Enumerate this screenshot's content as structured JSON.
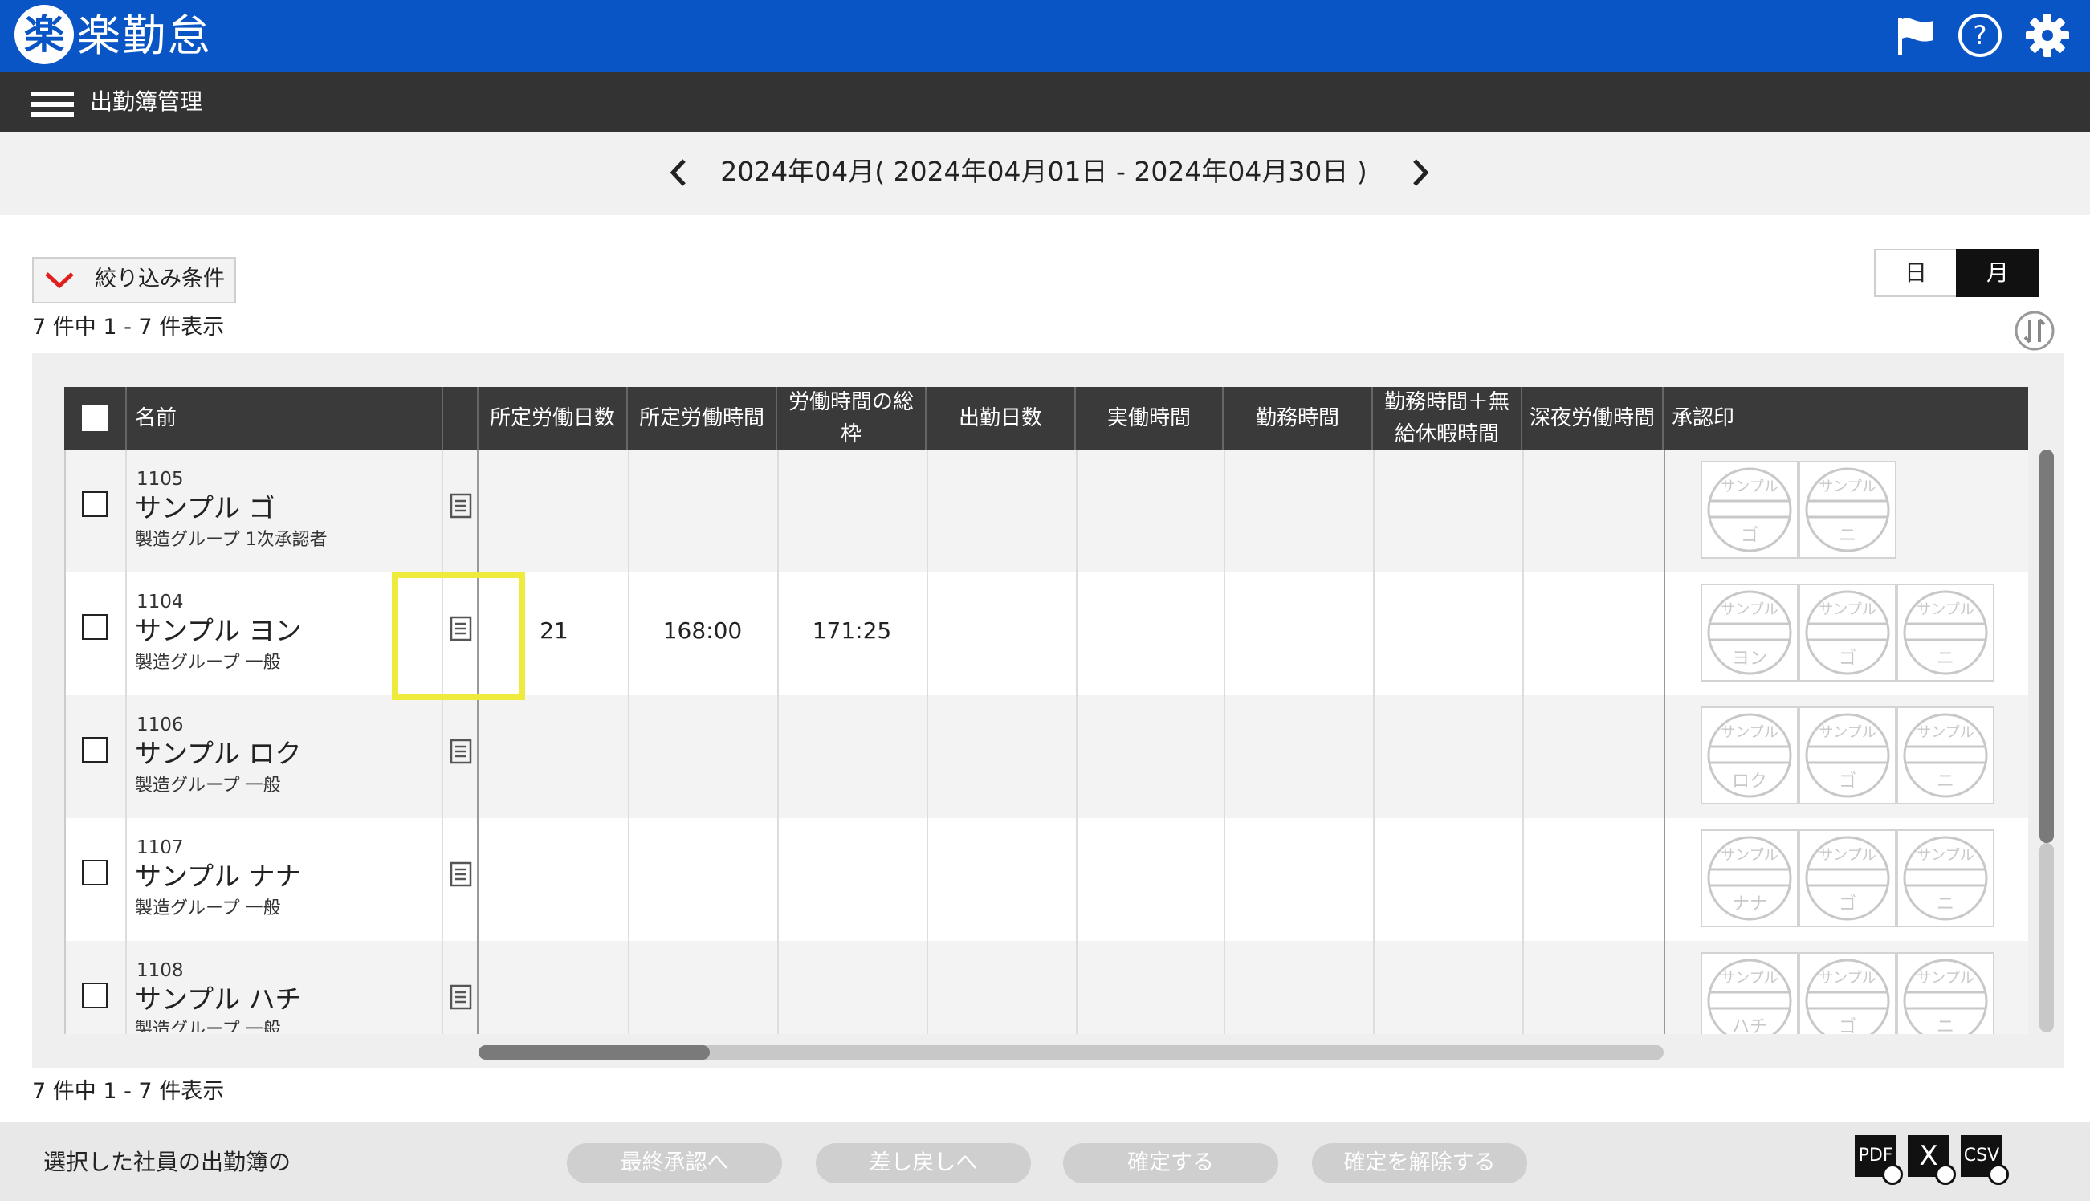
{
  "app": {
    "logo_glyph": "楽",
    "title": "楽勤怠",
    "brand_color": "#0a55c6"
  },
  "header_icons": [
    "flag-icon",
    "help-icon",
    "gear-icon"
  ],
  "subbar": {
    "title": "出勤簿管理"
  },
  "period": {
    "label": "2024年04月( 2024年04月01日 - 2024年04月30日 )"
  },
  "filter": {
    "label": "絞り込み条件"
  },
  "view_toggle": {
    "day": "日",
    "month": "月",
    "selected": "月"
  },
  "result_count": {
    "top": "7 件中 1 - 7 件表示",
    "bottom": "7 件中 1 - 7 件表示"
  },
  "table": {
    "columns": {
      "name": "名前",
      "scheduled_days": "所定労働日数",
      "scheduled_hours": "所定労働時間",
      "total_frame": "労働時間の総枠",
      "attendance_days": "出勤日数",
      "actual_hours": "実働時間",
      "work_hours": "勤務時間",
      "work_plus_unpaid": "勤務時間＋無給休暇時間",
      "night_hours": "深夜労働時間",
      "approval": "承認印"
    },
    "rows": [
      {
        "no": "1105",
        "name": "サンプル ゴ",
        "group": "製造グループ 1次承認者",
        "scheduled_days": "",
        "scheduled_hours": "",
        "total_frame": "",
        "stamps": [
          {
            "top": "サンプル",
            "bottom": "ゴ"
          },
          {
            "top": "サンプル",
            "bottom": "ニ"
          }
        ]
      },
      {
        "no": "1104",
        "name": "サンプル ヨン",
        "group": "製造グループ 一般",
        "scheduled_days": "21",
        "scheduled_hours": "168:00",
        "total_frame": "171:25",
        "stamps": [
          {
            "top": "サンプル",
            "bottom": "ヨン"
          },
          {
            "top": "サンプル",
            "bottom": "ゴ"
          },
          {
            "top": "サンプル",
            "bottom": "ニ"
          }
        ]
      },
      {
        "no": "1106",
        "name": "サンプル ロク",
        "group": "製造グループ 一般",
        "scheduled_days": "",
        "scheduled_hours": "",
        "total_frame": "",
        "stamps": [
          {
            "top": "サンプル",
            "bottom": "ロク"
          },
          {
            "top": "サンプル",
            "bottom": "ゴ"
          },
          {
            "top": "サンプル",
            "bottom": "ニ"
          }
        ]
      },
      {
        "no": "1107",
        "name": "サンプル ナナ",
        "group": "製造グループ 一般",
        "scheduled_days": "",
        "scheduled_hours": "",
        "total_frame": "",
        "stamps": [
          {
            "top": "サンプル",
            "bottom": "ナナ"
          },
          {
            "top": "サンプル",
            "bottom": "ゴ"
          },
          {
            "top": "サンプル",
            "bottom": "ニ"
          }
        ]
      },
      {
        "no": "1108",
        "name": "サンプル ハチ",
        "group": "製造グループ 一般",
        "scheduled_days": "",
        "scheduled_hours": "",
        "total_frame": "",
        "stamps": [
          {
            "top": "サンプル",
            "bottom": "ハチ"
          },
          {
            "top": "サンプル",
            "bottom": "ゴ"
          },
          {
            "top": "サンプル",
            "bottom": "ニ"
          }
        ]
      }
    ]
  },
  "bottom": {
    "label": "選択した社員の出勤簿の",
    "actions": [
      "最終承認へ",
      "差し戻しへ",
      "確定する",
      "確定を解除する"
    ],
    "exports": [
      "PDF",
      "X",
      "CSV"
    ]
  }
}
